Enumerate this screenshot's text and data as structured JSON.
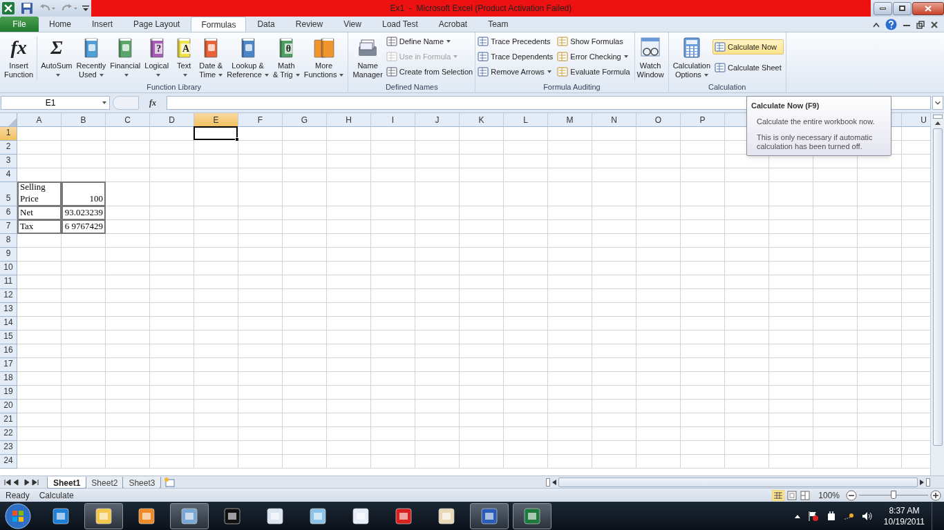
{
  "title_bar": {
    "title": "Ex1  -  Microsoft Excel (Product Activation Failed)"
  },
  "tabs": [
    {
      "label": "File",
      "kind": "file",
      "selected": false
    },
    {
      "label": "Home",
      "kind": "tab",
      "selected": false
    },
    {
      "label": "Insert",
      "kind": "tab",
      "selected": false
    },
    {
      "label": "Page Layout",
      "kind": "tab",
      "selected": false
    },
    {
      "label": "Formulas",
      "kind": "tab",
      "selected": true
    },
    {
      "label": "Data",
      "kind": "tab",
      "selected": false
    },
    {
      "label": "Review",
      "kind": "tab",
      "selected": false
    },
    {
      "label": "View",
      "kind": "tab",
      "selected": false
    },
    {
      "label": "Load Test",
      "kind": "tab",
      "selected": false
    },
    {
      "label": "Acrobat",
      "kind": "tab",
      "selected": false
    },
    {
      "label": "Team",
      "kind": "tab",
      "selected": false
    }
  ],
  "function_library": {
    "title": "Function Library",
    "buttons": [
      {
        "lines": [
          "Insert",
          "Function"
        ],
        "glyph": "fx",
        "kind": "glyph",
        "menu": false
      },
      {
        "lines": [
          "AutoSum"
        ],
        "glyph": "Σ",
        "kind": "glyph",
        "menu": true
      },
      {
        "lines": [
          "Recently",
          "Used"
        ],
        "kind": "book",
        "menu": true
      },
      {
        "lines": [
          "Financial"
        ],
        "kind": "book",
        "menu": true
      },
      {
        "lines": [
          "Logical"
        ],
        "glyph": "?",
        "kind": "book",
        "menu": true
      },
      {
        "lines": [
          "Text"
        ],
        "glyph": "A",
        "kind": "book",
        "menu": true
      },
      {
        "lines": [
          "Date &",
          "Time"
        ],
        "kind": "book",
        "menu": true
      },
      {
        "lines": [
          "Lookup &",
          "Reference"
        ],
        "kind": "book",
        "menu": true
      },
      {
        "lines": [
          "Math",
          "& Trig"
        ],
        "glyph": "θ",
        "kind": "book",
        "menu": true
      },
      {
        "lines": [
          "More",
          "Functions"
        ],
        "kind": "books",
        "menu": true
      }
    ]
  },
  "defined_names": {
    "title": "Defined Names",
    "big": {
      "lines": [
        "Name",
        "Manager"
      ]
    },
    "items": [
      {
        "label": "Define Name",
        "menu": true,
        "disabled": false
      },
      {
        "label": "Use in Formula",
        "menu": true,
        "disabled": true
      },
      {
        "label": "Create from Selection",
        "menu": false,
        "disabled": false
      }
    ]
  },
  "formula_auditing": {
    "title": "Formula Auditing",
    "columns": [
      [
        {
          "label": "Trace Precedents",
          "menu": false
        },
        {
          "label": "Trace Dependents",
          "menu": false
        },
        {
          "label": "Remove Arrows",
          "menu": true
        }
      ],
      [
        {
          "label": "Show Formulas",
          "menu": false
        },
        {
          "label": "Error Checking",
          "menu": true
        },
        {
          "label": "Evaluate Formula",
          "menu": false
        }
      ]
    ],
    "big": {
      "lines": [
        "Watch",
        "Window"
      ]
    }
  },
  "calculation": {
    "title": "Calculation",
    "big": {
      "lines": [
        "Calculation",
        "Options"
      ],
      "menu": true
    },
    "items": [
      {
        "label": "Calculate Now",
        "selected": true
      },
      {
        "label": "Calculate Sheet",
        "selected": false
      }
    ]
  },
  "formula_bar": {
    "name_box": "E1",
    "fx": "fx"
  },
  "columns": [
    {
      "label": "A",
      "selected": false
    },
    {
      "label": "B",
      "selected": false
    },
    {
      "label": "C",
      "selected": false
    },
    {
      "label": "D",
      "selected": false
    },
    {
      "label": "E",
      "selected": true
    },
    {
      "label": "F",
      "selected": false
    },
    {
      "label": "G",
      "selected": false
    },
    {
      "label": "H",
      "selected": false
    },
    {
      "label": "I",
      "selected": false
    },
    {
      "label": "J",
      "selected": false
    },
    {
      "label": "K",
      "selected": false
    },
    {
      "label": "L",
      "selected": false
    },
    {
      "label": "M",
      "selected": false
    },
    {
      "label": "N",
      "selected": false
    },
    {
      "label": "O",
      "selected": false
    },
    {
      "label": "P",
      "selected": false
    },
    {},
    {},
    {},
    {},
    {
      "label": "U",
      "selected": false
    }
  ],
  "rows": [
    {
      "label": "1",
      "selected": true
    },
    {
      "label": "2",
      "selected": false
    },
    {
      "label": "3",
      "selected": false
    },
    {
      "label": "4",
      "selected": false
    },
    {
      "label": "5",
      "selected": false,
      "kind": "wrapped",
      "cells": [
        {
          "text": "Selling Price",
          "kind": "text"
        },
        {
          "text": "100",
          "kind": "number"
        }
      ]
    },
    {
      "label": "6",
      "selected": false,
      "cells": [
        {
          "text": "Net",
          "kind": "text"
        },
        {
          "text": "93.023239",
          "kind": "number"
        }
      ]
    },
    {
      "label": "7",
      "selected": false,
      "cells": [
        {
          "text": "Tax",
          "kind": "text"
        },
        {
          "text": "6 9767429",
          "kind": "number"
        }
      ]
    },
    {
      "label": "8",
      "selected": false
    },
    {
      "label": "9",
      "selected": false
    },
    {
      "label": "10",
      "selected": false
    },
    {
      "label": "11",
      "selected": false
    },
    {
      "label": "12",
      "selected": false
    },
    {
      "label": "13",
      "selected": false
    },
    {
      "label": "14",
      "selected": false
    },
    {
      "label": "15",
      "selected": false
    },
    {
      "label": "16",
      "selected": false
    },
    {
      "label": "17",
      "selected": false
    },
    {
      "label": "18",
      "selected": false
    },
    {
      "label": "19",
      "selected": false
    },
    {
      "label": "20",
      "selected": false
    },
    {
      "label": "21",
      "selected": false
    },
    {
      "label": "22",
      "selected": false
    },
    {
      "label": "23",
      "selected": false
    },
    {
      "label": "24",
      "selected": false
    }
  ],
  "tooltip": {
    "title": "Calculate Now (F9)",
    "paragraphs": [
      "Calculate the entire workbook now.",
      "This is only necessary if automatic calculation has been turned off."
    ]
  },
  "sheets": [
    {
      "label": "Sheet1",
      "selected": true
    },
    {
      "label": "Sheet2",
      "selected": false
    },
    {
      "label": "Sheet3",
      "selected": false
    }
  ],
  "status_bar": {
    "texts": [
      "Ready",
      "Calculate"
    ],
    "zoom": "100%",
    "zoom_slider": {
      "level": 0.5
    }
  },
  "taskbar": {
    "apps": [
      {
        "open": false
      },
      {
        "open": true
      },
      {
        "open": false
      },
      {
        "open": true
      },
      {
        "open": false
      },
      {
        "open": false
      },
      {
        "open": false
      },
      {
        "open": false
      },
      {
        "open": false
      },
      {
        "open": false
      },
      {
        "open": true
      },
      {
        "open": true
      }
    ],
    "time": "8:37 AM",
    "date": "10/19/2011"
  }
}
